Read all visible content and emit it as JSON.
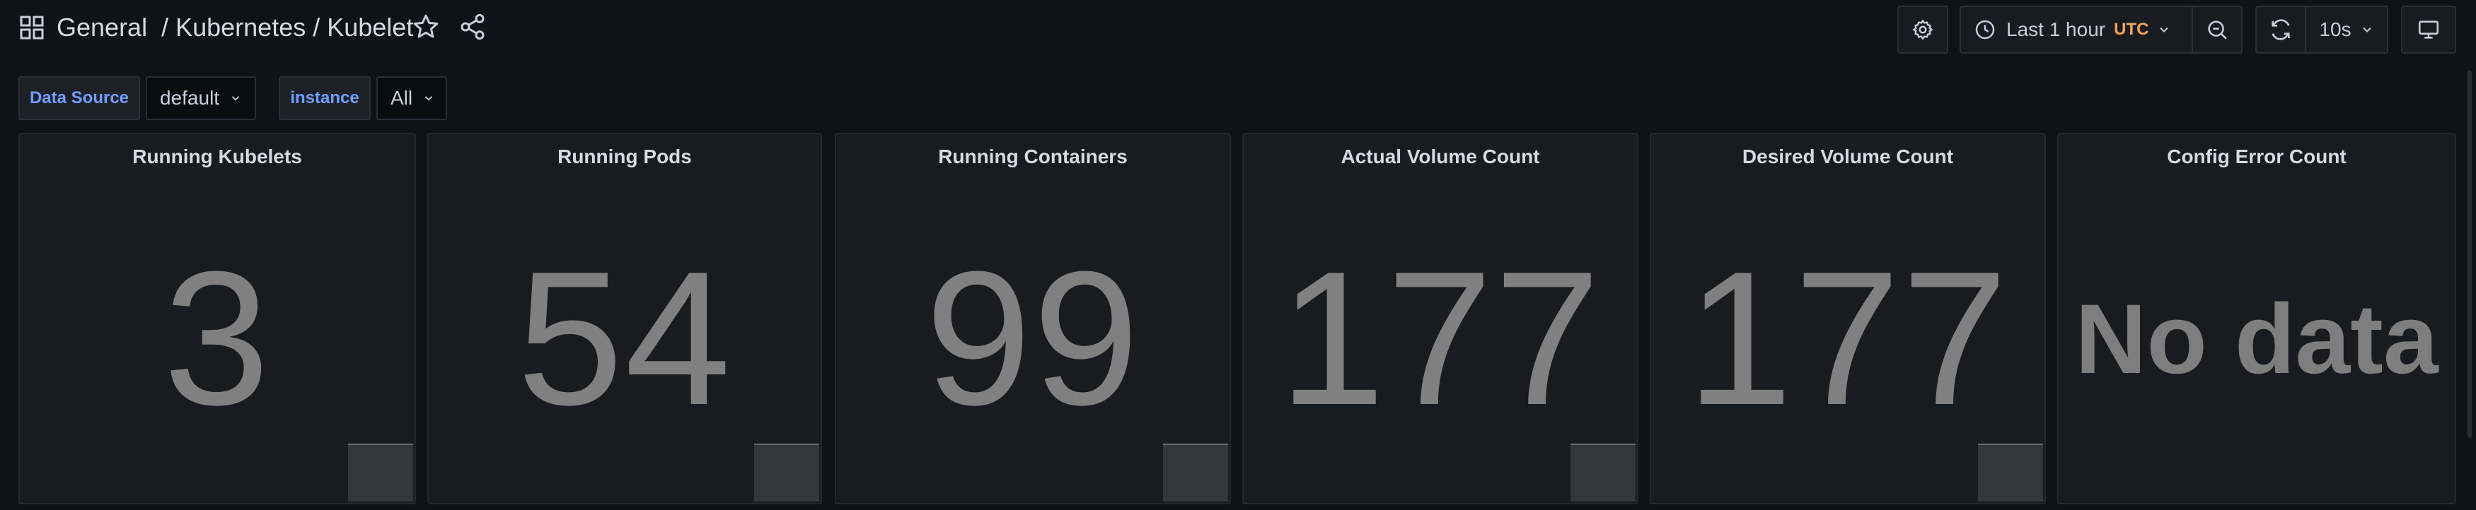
{
  "header": {
    "breadcrumb": "General  / Kubernetes / Kubelet"
  },
  "toolbar": {
    "time_range_label": "Last 1 hour",
    "timezone": "UTC",
    "refresh_interval": "10s"
  },
  "variables": {
    "datasource_label": "Data Source",
    "datasource_value": "default",
    "instance_label": "instance",
    "instance_value": "All"
  },
  "panels": [
    {
      "title": "Running Kubelets",
      "value": "3"
    },
    {
      "title": "Running Pods",
      "value": "54"
    },
    {
      "title": "Running Containers",
      "value": "99"
    },
    {
      "title": "Actual Volume Count",
      "value": "177"
    },
    {
      "title": "Desired Volume Count",
      "value": "177"
    },
    {
      "title": "Config Error Count",
      "value": "No data"
    }
  ],
  "colors": {
    "background": "#111217",
    "panel_bg": "#181b1f",
    "value_text": "#808080",
    "timezone_accent": "#f5a35c",
    "variable_label": "#6e9fff"
  },
  "icons": [
    "apps-icon",
    "star-icon",
    "share-icon",
    "gear-icon",
    "clock-icon",
    "chevron-down-icon",
    "zoom-out-icon",
    "refresh-icon",
    "tv-icon"
  ]
}
